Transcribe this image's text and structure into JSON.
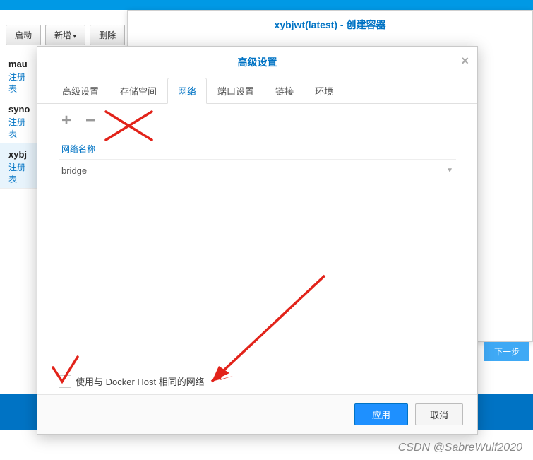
{
  "outer": {
    "title": "xybjwt(latest) - 创建容器"
  },
  "toolbar": {
    "start": "启动",
    "add": "新增",
    "delete": "删除"
  },
  "sidebar": {
    "items": [
      {
        "title": "mau",
        "sub": "注册表"
      },
      {
        "title": "syno",
        "sub": "注册表"
      },
      {
        "title": "xybj",
        "sub": "注册表"
      }
    ]
  },
  "inner": {
    "title": "高级设置",
    "tabs": [
      "高级设置",
      "存储空间",
      "网络",
      "端口设置",
      "链接",
      "环境"
    ],
    "column_header": "网络名称",
    "network_value": "bridge",
    "checkbox_label": "使用与 Docker Host 相同的网络",
    "apply": "应用",
    "cancel": "取消"
  },
  "next_step": "下一步",
  "watermark": "CSDN @SabreWulf2020"
}
